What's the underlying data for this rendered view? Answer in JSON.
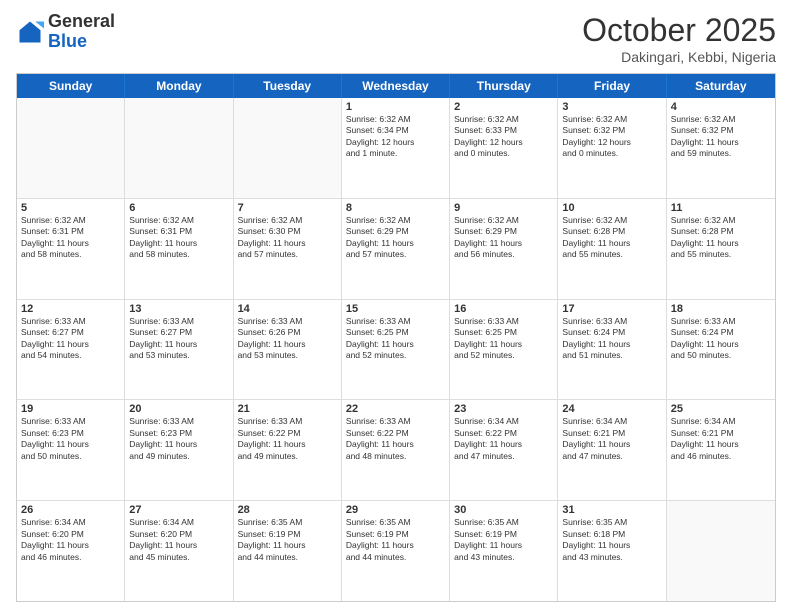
{
  "logo": {
    "general": "General",
    "blue": "Blue"
  },
  "header": {
    "month": "October 2025",
    "location": "Dakingari, Kebbi, Nigeria"
  },
  "days": [
    "Sunday",
    "Monday",
    "Tuesday",
    "Wednesday",
    "Thursday",
    "Friday",
    "Saturday"
  ],
  "weeks": [
    [
      {
        "day": "",
        "info": ""
      },
      {
        "day": "",
        "info": ""
      },
      {
        "day": "",
        "info": ""
      },
      {
        "day": "1",
        "info": "Sunrise: 6:32 AM\nSunset: 6:34 PM\nDaylight: 12 hours\nand 1 minute."
      },
      {
        "day": "2",
        "info": "Sunrise: 6:32 AM\nSunset: 6:33 PM\nDaylight: 12 hours\nand 0 minutes."
      },
      {
        "day": "3",
        "info": "Sunrise: 6:32 AM\nSunset: 6:32 PM\nDaylight: 12 hours\nand 0 minutes."
      },
      {
        "day": "4",
        "info": "Sunrise: 6:32 AM\nSunset: 6:32 PM\nDaylight: 11 hours\nand 59 minutes."
      }
    ],
    [
      {
        "day": "5",
        "info": "Sunrise: 6:32 AM\nSunset: 6:31 PM\nDaylight: 11 hours\nand 58 minutes."
      },
      {
        "day": "6",
        "info": "Sunrise: 6:32 AM\nSunset: 6:31 PM\nDaylight: 11 hours\nand 58 minutes."
      },
      {
        "day": "7",
        "info": "Sunrise: 6:32 AM\nSunset: 6:30 PM\nDaylight: 11 hours\nand 57 minutes."
      },
      {
        "day": "8",
        "info": "Sunrise: 6:32 AM\nSunset: 6:29 PM\nDaylight: 11 hours\nand 57 minutes."
      },
      {
        "day": "9",
        "info": "Sunrise: 6:32 AM\nSunset: 6:29 PM\nDaylight: 11 hours\nand 56 minutes."
      },
      {
        "day": "10",
        "info": "Sunrise: 6:32 AM\nSunset: 6:28 PM\nDaylight: 11 hours\nand 55 minutes."
      },
      {
        "day": "11",
        "info": "Sunrise: 6:32 AM\nSunset: 6:28 PM\nDaylight: 11 hours\nand 55 minutes."
      }
    ],
    [
      {
        "day": "12",
        "info": "Sunrise: 6:33 AM\nSunset: 6:27 PM\nDaylight: 11 hours\nand 54 minutes."
      },
      {
        "day": "13",
        "info": "Sunrise: 6:33 AM\nSunset: 6:27 PM\nDaylight: 11 hours\nand 53 minutes."
      },
      {
        "day": "14",
        "info": "Sunrise: 6:33 AM\nSunset: 6:26 PM\nDaylight: 11 hours\nand 53 minutes."
      },
      {
        "day": "15",
        "info": "Sunrise: 6:33 AM\nSunset: 6:25 PM\nDaylight: 11 hours\nand 52 minutes."
      },
      {
        "day": "16",
        "info": "Sunrise: 6:33 AM\nSunset: 6:25 PM\nDaylight: 11 hours\nand 52 minutes."
      },
      {
        "day": "17",
        "info": "Sunrise: 6:33 AM\nSunset: 6:24 PM\nDaylight: 11 hours\nand 51 minutes."
      },
      {
        "day": "18",
        "info": "Sunrise: 6:33 AM\nSunset: 6:24 PM\nDaylight: 11 hours\nand 50 minutes."
      }
    ],
    [
      {
        "day": "19",
        "info": "Sunrise: 6:33 AM\nSunset: 6:23 PM\nDaylight: 11 hours\nand 50 minutes."
      },
      {
        "day": "20",
        "info": "Sunrise: 6:33 AM\nSunset: 6:23 PM\nDaylight: 11 hours\nand 49 minutes."
      },
      {
        "day": "21",
        "info": "Sunrise: 6:33 AM\nSunset: 6:22 PM\nDaylight: 11 hours\nand 49 minutes."
      },
      {
        "day": "22",
        "info": "Sunrise: 6:33 AM\nSunset: 6:22 PM\nDaylight: 11 hours\nand 48 minutes."
      },
      {
        "day": "23",
        "info": "Sunrise: 6:34 AM\nSunset: 6:22 PM\nDaylight: 11 hours\nand 47 minutes."
      },
      {
        "day": "24",
        "info": "Sunrise: 6:34 AM\nSunset: 6:21 PM\nDaylight: 11 hours\nand 47 minutes."
      },
      {
        "day": "25",
        "info": "Sunrise: 6:34 AM\nSunset: 6:21 PM\nDaylight: 11 hours\nand 46 minutes."
      }
    ],
    [
      {
        "day": "26",
        "info": "Sunrise: 6:34 AM\nSunset: 6:20 PM\nDaylight: 11 hours\nand 46 minutes."
      },
      {
        "day": "27",
        "info": "Sunrise: 6:34 AM\nSunset: 6:20 PM\nDaylight: 11 hours\nand 45 minutes."
      },
      {
        "day": "28",
        "info": "Sunrise: 6:35 AM\nSunset: 6:19 PM\nDaylight: 11 hours\nand 44 minutes."
      },
      {
        "day": "29",
        "info": "Sunrise: 6:35 AM\nSunset: 6:19 PM\nDaylight: 11 hours\nand 44 minutes."
      },
      {
        "day": "30",
        "info": "Sunrise: 6:35 AM\nSunset: 6:19 PM\nDaylight: 11 hours\nand 43 minutes."
      },
      {
        "day": "31",
        "info": "Sunrise: 6:35 AM\nSunset: 6:18 PM\nDaylight: 11 hours\nand 43 minutes."
      },
      {
        "day": "",
        "info": ""
      }
    ]
  ]
}
